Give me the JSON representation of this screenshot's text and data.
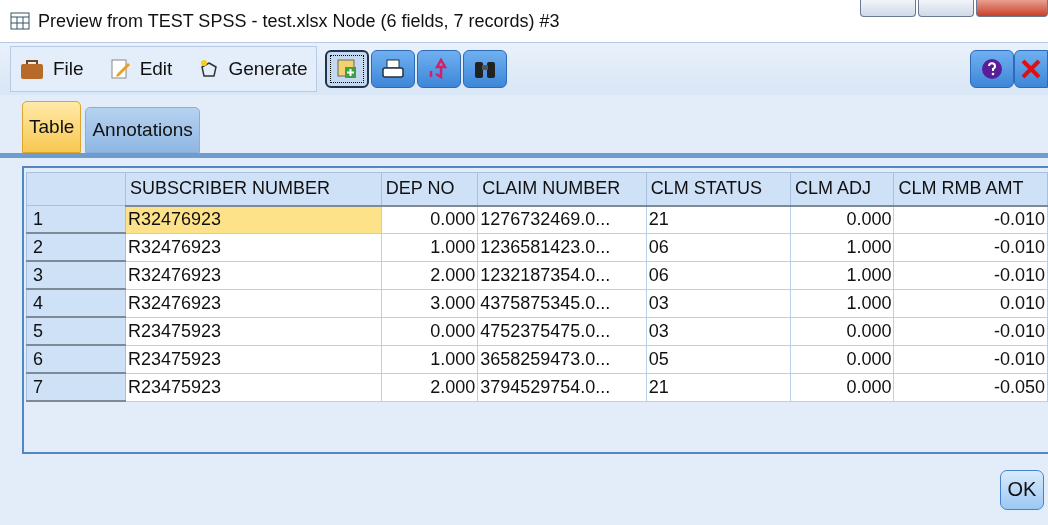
{
  "window": {
    "title": "Preview from TEST SPSS - test.xlsx Node (6 fields, 7 records) #3"
  },
  "menu": [
    {
      "label": "File"
    },
    {
      "label": "Edit"
    },
    {
      "label": "Generate"
    }
  ],
  "toolbar": [
    {
      "selected": true
    },
    {
      "selected": false
    },
    {
      "selected": false
    },
    {
      "selected": false
    }
  ],
  "tabs": [
    {
      "label": "Table",
      "selected": true
    },
    {
      "label": "Annotations",
      "selected": false
    }
  ],
  "table": {
    "columns": [
      "SUBSCRIBER NUMBER",
      "DEP NO",
      "CLAIM NUMBER",
      "CLM STATUS",
      "CLM ADJ",
      "CLM RMB AMT"
    ],
    "rows": [
      {
        "index": "1",
        "cells": [
          "R32476923",
          "0.000",
          "1276732469.0...",
          "21",
          "0.000",
          "-0.010"
        ],
        "selected": true
      },
      {
        "index": "2",
        "cells": [
          "R32476923",
          "1.000",
          "1236581423.0...",
          "06",
          "1.000",
          "-0.010"
        ],
        "selected": false
      },
      {
        "index": "3",
        "cells": [
          "R32476923",
          "2.000",
          "1232187354.0...",
          "06",
          "1.000",
          "-0.010"
        ],
        "selected": false
      },
      {
        "index": "4",
        "cells": [
          "R32476923",
          "3.000",
          "4375875345.0...",
          "03",
          "1.000",
          "0.010"
        ],
        "selected": false
      },
      {
        "index": "5",
        "cells": [
          "R23475923",
          "0.000",
          "4752375475.0...",
          "03",
          "0.000",
          "-0.010"
        ],
        "selected": false
      },
      {
        "index": "6",
        "cells": [
          "R23475923",
          "1.000",
          "3658259473.0...",
          "05",
          "0.000",
          "-0.010"
        ],
        "selected": false
      },
      {
        "index": "7",
        "cells": [
          "R23475923",
          "2.000",
          "3794529754.0...",
          "21",
          "0.000",
          "-0.050"
        ],
        "selected": false
      }
    ]
  },
  "buttons": [
    {
      "label": "OK"
    }
  ]
}
